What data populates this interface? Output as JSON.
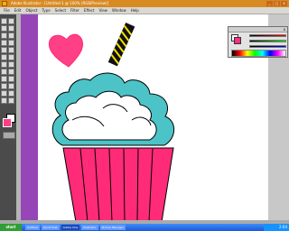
{
  "window": {
    "title": "Adobe Illustrator - [Untitled-1 @ 100% (RGB/Preview)]",
    "controls": [
      "_",
      "□",
      "x"
    ]
  },
  "menubar": {
    "items": [
      "File",
      "Edit",
      "Object",
      "Type",
      "Select",
      "Filter",
      "Effect",
      "View",
      "Window",
      "Help"
    ]
  },
  "tools": {
    "icons": [
      "selection",
      "direct-selection",
      "magic-wand",
      "lasso",
      "pen",
      "type",
      "line",
      "rectangle",
      "paintbrush",
      "pencil",
      "rotate",
      "scale",
      "warp",
      "free-transform",
      "symbol-sprayer",
      "graph",
      "mesh",
      "gradient",
      "eyedropper",
      "blend",
      "slice",
      "scissors",
      "hand",
      "zoom"
    ],
    "fill_color": "#ff3d87",
    "stroke_color": "#ffffff"
  },
  "color_panel": {
    "close_label": "x",
    "fill_color": "#ff2e80",
    "stroke_color": "#ffffff"
  },
  "taskbar": {
    "start_label": "start",
    "tasks": [
      "Untitled",
      "Quick Post",
      "Adobe Illus",
      "Illustrator",
      "Picture Manager"
    ],
    "active_task": 2,
    "time": "2:04"
  },
  "colors": {
    "frosting_outline": "#4cc3c7",
    "cupcake_pink": "#ff2b78",
    "straw_yellow": "#f6e000",
    "heart_pink": "#ff3f86",
    "purple_bar": "#9646b7"
  }
}
